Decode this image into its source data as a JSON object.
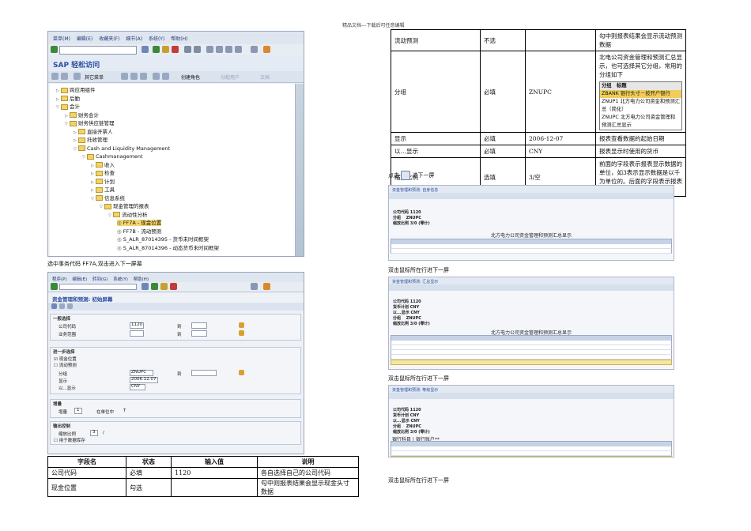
{
  "page": {
    "header_note": "精品文档---下载后可任意编辑"
  },
  "sap1": {
    "menus": [
      "菜单(M)",
      "编辑(E)",
      "收藏夹(F)",
      "细节(A)",
      "系统(Y)",
      "帮助(H)"
    ],
    "title": "SAP 轻松访问",
    "app_buttons": [
      "其它菜单",
      "创建角色",
      "分配用户",
      "文档"
    ],
    "tree": [
      {
        "label": "跨应用组件",
        "indent": 0,
        "open": false
      },
      {
        "label": "后勤",
        "indent": 0,
        "open": false
      },
      {
        "label": "会计",
        "indent": 0,
        "open": true
      },
      {
        "label": "财务会计",
        "indent": 1,
        "open": false
      },
      {
        "label": "财务供应链管理",
        "indent": 1,
        "open": true
      },
      {
        "label": "直接开票人",
        "indent": 2,
        "open": false
      },
      {
        "label": "托收管理",
        "indent": 2,
        "open": false
      },
      {
        "label": "Cash and Liquidity Management",
        "indent": 2,
        "open": true
      },
      {
        "label": "Cashmanagement",
        "indent": 3,
        "open": true
      },
      {
        "label": "收入",
        "indent": 4,
        "open": false
      },
      {
        "label": "检查",
        "indent": 4,
        "open": false
      },
      {
        "label": "计划",
        "indent": 4,
        "open": false
      },
      {
        "label": "工具",
        "indent": 4,
        "open": false
      },
      {
        "label": "信息系统",
        "indent": 4,
        "open": true
      },
      {
        "label": "现金管理的报表",
        "indent": 5,
        "open": true
      },
      {
        "label": "流动性分析",
        "indent": 6,
        "open": true
      },
      {
        "label": "FF7A - 现金位置",
        "indent": 7,
        "tx": true,
        "sel": true
      },
      {
        "label": "FF7B - 流动预测",
        "indent": 7,
        "tx": true
      },
      {
        "label": "S_ALR_87014395 - 货币未时间框架",
        "indent": 7,
        "tx": true
      },
      {
        "label": "S_ALR_87014396 - 动态货币未时间框架",
        "indent": 7,
        "tx": true
      }
    ]
  },
  "caption1": "选中事务代码 FF7A,双击进入下一屏幕",
  "sap2": {
    "menus": [
      "程序(P)",
      "编辑(E)",
      "转到(G)",
      "系统(Y)",
      "帮助(H)"
    ],
    "title": "资金管理和预测: 初始屏幕",
    "groups": [
      {
        "title": "一般选择",
        "fields": [
          {
            "label": "公司代码",
            "value": "1120",
            "to": "到"
          },
          {
            "label": "业务范围",
            "value": "",
            "to": "到"
          }
        ]
      },
      {
        "title": "进一步选择",
        "fields": [
          {
            "label": "现金位置",
            "checkbox": true,
            "checked": true
          },
          {
            "label": "流动预测",
            "checkbox": true,
            "checked": false
          },
          {
            "label": "分组",
            "value": "ZNUPC",
            "to": "到"
          },
          {
            "label": "显示",
            "value": "2006.12.07"
          },
          {
            "label": "以...显示",
            "value": "CNY"
          }
        ]
      },
      {
        "title": "增量",
        "fields": [
          {
            "label": "增量",
            "value": "1",
            "extra": "在单位中",
            "extra2": "T"
          }
        ]
      },
      {
        "title": "输出控制",
        "fields": [
          {
            "label": "缩放比例",
            "value": "3",
            "extra": "/"
          },
          {
            "label": "用于数据库存",
            "checkbox": true,
            "checked": false
          }
        ]
      }
    ]
  },
  "table1": {
    "headers": [
      "字段名",
      "状态",
      "输入值",
      "说明"
    ],
    "rows": [
      [
        "公司代码",
        "必填",
        "1120",
        "各自选择自己的公司代码"
      ],
      [
        "现金位置",
        "勾选",
        "",
        "勾中则报表结果会显示现金头寸数据"
      ]
    ]
  },
  "table2": {
    "rows": [
      {
        "field": "流动预测",
        "status": "不选",
        "value": "",
        "desc": "勾中则报表结果会显示流动预测数据"
      },
      {
        "field": "分组",
        "status": "必填",
        "value": "ZNUPC",
        "desc": "北电公司资金管理和预测汇总显示，也可选择其它分组，常用的分组如下",
        "grouplist": {
          "headers": [
            "分组",
            "标题"
          ],
          "rows": [
            [
              "ZBANK",
              "银行头寸－按开户银行"
            ],
            [
              "ZNUP1",
              "北方电力公司资金和预测汇总（简化）"
            ],
            [
              "ZNUPC",
              "北方电力公司资金管理和预测汇总显示"
            ]
          ]
        }
      },
      {
        "field": "显示",
        "status": "必填",
        "value": "2006-12-07",
        "desc": "报表查看数据的起始日期"
      },
      {
        "field": "以…显示",
        "status": "必填",
        "value": "CNY",
        "desc": "报表显示时使用的货币"
      },
      {
        "field": "缩放比例",
        "status": "选填",
        "value": "3/空",
        "desc": "前面的字段表示报表显示数据的单位，如3表示显示数据是以千为单位的。后面的字段表示报表显示数据的小数位数。"
      }
    ]
  },
  "caption_next": "进下一屏",
  "caption_click": "点击",
  "report1": {
    "title": "资金管理和预测: 自身信息",
    "info": [
      "公司代码 1120",
      "分组　 ZNUPC",
      "缩放比例 3/0 (零计)"
    ],
    "grid_title": "北方电力公司资金管理和预测汇总显示",
    "rows": 2
  },
  "caption2": "双击鼠标所在行进下一屏",
  "report2": {
    "title": "资金管理和预测: 汇总显示",
    "info": [
      "公司代码 1120",
      "货币计划 CNY",
      "以...显示 CNY",
      "分组　 ZNUPC",
      "缩放比例 3/0 (零计)"
    ],
    "grid_title": "北方电力公司资金管理和预测汇总显示",
    "rows": 5
  },
  "caption3": "双击鼠标所在行进下一屏",
  "report3": {
    "title": "资金管理和预测: 等级显示",
    "info": [
      "公司代码 1120",
      "货币计划 CNY",
      "以...显示 CNY",
      "分组　 ZNUPC",
      "缩放比例 3/0 (零计)"
    ],
    "grid_title": "银行科目 | 银行账户**",
    "rows": 3
  },
  "caption4": "双击鼠标所在行进下一屏"
}
